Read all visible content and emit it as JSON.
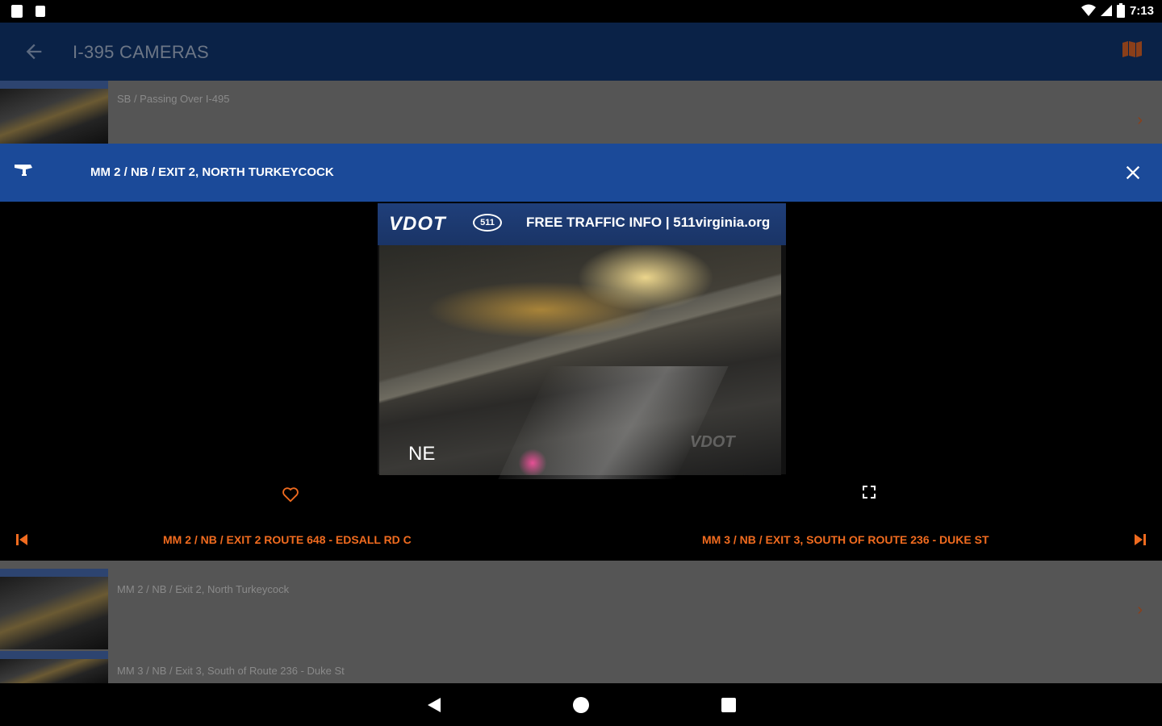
{
  "status_bar": {
    "time": "7:13"
  },
  "app_bar": {
    "title": "I-395 CAMERAS"
  },
  "list": {
    "row_top": {
      "text": "SB / Passing Over I-495"
    },
    "row_bottom_a": {
      "text": "MM 2  /  NB  /  Exit 2, North Turkeycock"
    },
    "row_bottom_b": {
      "text": "MM 3  /  NB  /  Exit 3, South of Route 236 - Duke St"
    }
  },
  "dialog": {
    "title": "MM 2  /  NB  /  EXIT 2, NORTH TURKEYCOCK",
    "camera": {
      "banner_logo": "VDOT",
      "banner_badge": "511",
      "banner_text": "FREE TRAFFIC INFO | 511virginia.org",
      "direction_label": "NE",
      "watermark": "VDOT"
    },
    "prev_label": "MM 2  /  NB  /  EXIT 2 ROUTE 648 - EDSALL RD C",
    "next_label": "MM 3  /  NB  /  EXIT 3, SOUTH OF ROUTE 236 - DUKE ST"
  },
  "colors": {
    "accent": "#f06b1f",
    "dialog_header": "#1b4a99",
    "app_bar": "#0a2247"
  },
  "icons": {
    "back": "arrow-left-icon",
    "map": "map-icon",
    "camera": "camera-icon",
    "close": "close-icon",
    "favorite": "heart-icon",
    "fullscreen": "fullscreen-icon",
    "previous": "skip-previous-icon",
    "next": "skip-next-icon"
  }
}
